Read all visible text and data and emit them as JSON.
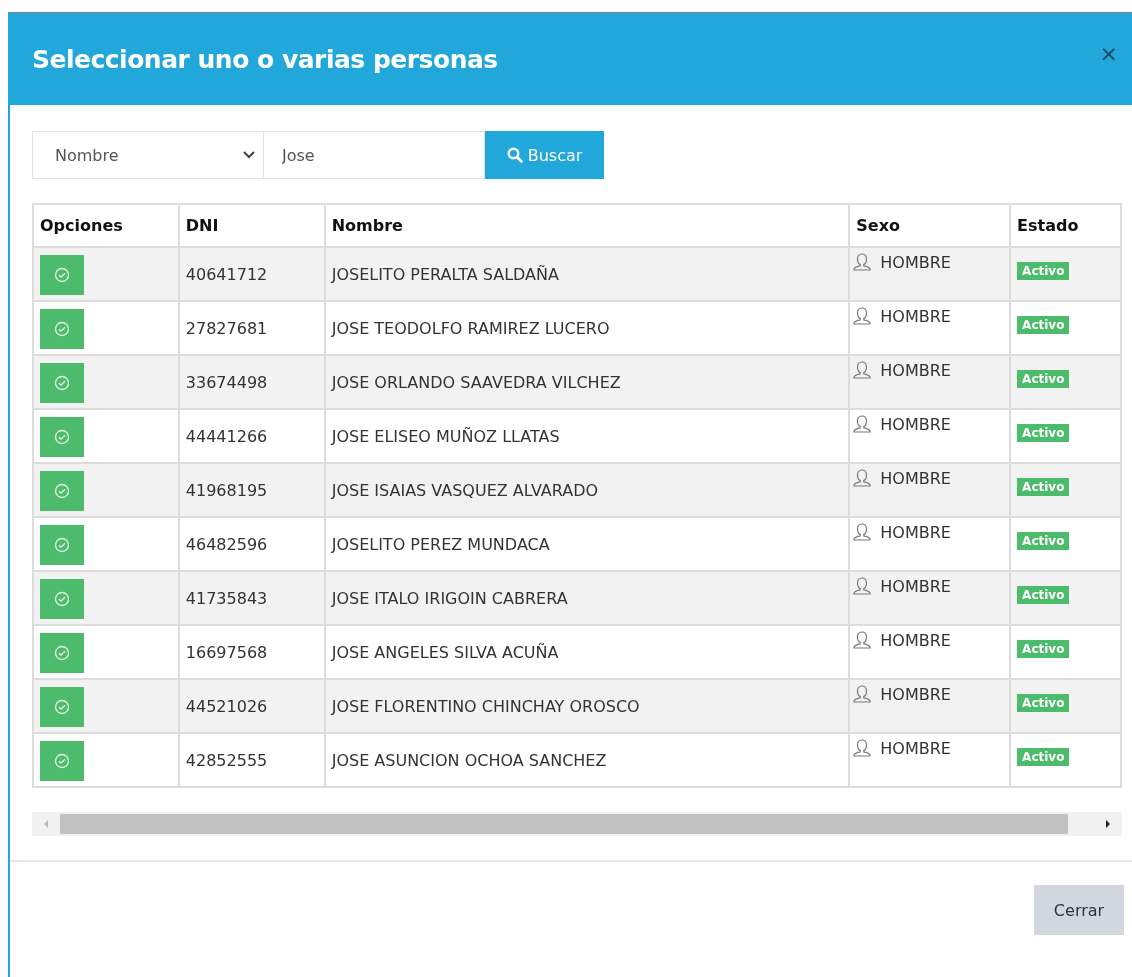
{
  "modal": {
    "title": "Seleccionar uno o varias personas",
    "close": "×"
  },
  "search": {
    "field_select": "Nombre",
    "query": "Jose",
    "button": "Buscar"
  },
  "table": {
    "columns": [
      "Opciones",
      "DNI",
      "Nombre",
      "Sexo",
      "Estado"
    ],
    "rows": [
      {
        "dni": "40641712",
        "nombre": "JOSELITO PERALTA SALDAÑA",
        "sexo": "HOMBRE",
        "estado": "Activo"
      },
      {
        "dni": "27827681",
        "nombre": "JOSE TEODOLFO RAMIREZ LUCERO",
        "sexo": "HOMBRE",
        "estado": "Activo"
      },
      {
        "dni": "33674498",
        "nombre": "JOSE ORLANDO SAAVEDRA VILCHEZ",
        "sexo": "HOMBRE",
        "estado": "Activo"
      },
      {
        "dni": "44441266",
        "nombre": "JOSE ELISEO MUÑOZ LLATAS",
        "sexo": "HOMBRE",
        "estado": "Activo"
      },
      {
        "dni": "41968195",
        "nombre": "JOSE ISAIAS VASQUEZ ALVARADO",
        "sexo": "HOMBRE",
        "estado": "Activo"
      },
      {
        "dni": "46482596",
        "nombre": "JOSELITO PEREZ MUNDACA",
        "sexo": "HOMBRE",
        "estado": "Activo"
      },
      {
        "dni": "41735843",
        "nombre": "JOSE ITALO IRIGOIN CABRERA",
        "sexo": "HOMBRE",
        "estado": "Activo"
      },
      {
        "dni": "16697568",
        "nombre": "JOSE ANGELES SILVA ACUÑA",
        "sexo": "HOMBRE",
        "estado": "Activo"
      },
      {
        "dni": "44521026",
        "nombre": "JOSE FLORENTINO CHINCHAY OROSCO",
        "sexo": "HOMBRE",
        "estado": "Activo"
      },
      {
        "dni": "42852555",
        "nombre": "JOSE ASUNCION OCHOA SANCHEZ",
        "sexo": "HOMBRE",
        "estado": "Activo"
      }
    ]
  },
  "footer": {
    "button": "Cerrar"
  }
}
